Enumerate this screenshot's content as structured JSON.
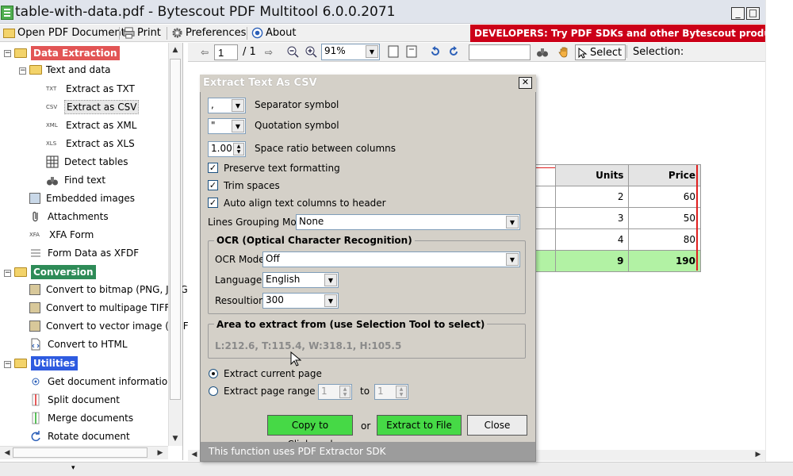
{
  "window": {
    "title": "table-with-data.pdf - Bytescout PDF Multitool 6.0.0.2071",
    "minimize": "_",
    "maximize": "□"
  },
  "menu": {
    "open_pdf": "Open PDF Document",
    "print": "Print",
    "preferences": "Preferences",
    "about": "About",
    "promo": "DEVELOPERS: Try PDF SDKs and other Bytescout products"
  },
  "sidebar": {
    "data_extraction": "Data Extraction",
    "text_and_data": "Text and data",
    "extract_txt_tag": "TXT",
    "extract_txt": "Extract as TXT",
    "extract_csv_tag": "CSV",
    "extract_csv": "Extract as CSV",
    "extract_xml_tag": "XML",
    "extract_xml": "Extract as XML",
    "extract_xls_tag": "XLS",
    "extract_xls": "Extract as XLS",
    "detect_tables": "Detect tables",
    "find_text": "Find text",
    "embedded_images": "Embedded images",
    "attachments": "Attachments",
    "xfa_tag": "XFA",
    "xfa_form": "XFA Form",
    "form_data_xfdf": "Form Data as XFDF",
    "conversion": "Conversion",
    "convert_bitmap": "Convert to bitmap (PNG, JPEG,",
    "convert_tiff": "Convert to multipage TIFF",
    "convert_emf": "Convert to vector image (EMF)",
    "convert_html": "Convert to HTML",
    "utilities": "Utilities",
    "get_info": "Get document information",
    "split": "Split document",
    "merge": "Merge documents",
    "rotate": "Rotate document"
  },
  "viewer": {
    "page_number": "1",
    "page_total": "/ 1",
    "zoom": "91%",
    "select_label": "Select",
    "selection_label": "Selection:",
    "table": {
      "headers": [
        "Units",
        "Price"
      ],
      "rows": [
        [
          "2",
          "60"
        ],
        [
          "3",
          "50"
        ],
        [
          "4",
          "80"
        ]
      ],
      "total": [
        "9",
        "190"
      ]
    }
  },
  "dialog": {
    "title": "Extract Text As CSV",
    "close": "✕",
    "separator_value": ",",
    "separator_label": "Separator symbol",
    "quotation_value": "\"",
    "quotation_label": "Quotation symbol",
    "space_ratio_value": "1.00",
    "space_ratio_label": "Space ratio between columns",
    "preserve_formatting": "Preserve text formatting",
    "trim_spaces": "Trim spaces",
    "auto_align": "Auto align text columns to header",
    "lines_grouping_label": "Lines Grouping Mode",
    "lines_grouping_value": "None",
    "ocr_group": "OCR (Optical Character Recognition)",
    "ocr_mode_label": "OCR Mode",
    "ocr_mode_value": "Off",
    "language_label": "Language",
    "language_value": "English",
    "resolution_label": "Resoultion",
    "resolution_value": "300",
    "area_group": "Area to extract from (use Selection Tool to select)",
    "area_value": "L:212.6, T:115.4, W:318.1, H:105.5",
    "extract_current": "Extract current page",
    "extract_range": "Extract page range from",
    "range_from": "1",
    "range_to_label": "to",
    "range_to": "1",
    "copy_clipboard": "Copy to Clipboard",
    "or_label": "or",
    "extract_file": "Extract to File",
    "close_button": "Close",
    "footer": "This function uses PDF Extractor SDK"
  },
  "colors": {
    "promo": "#cc0018",
    "data_extraction": "#e25555",
    "conversion": "#2e8b57",
    "utilities": "#2e5be0",
    "green_button": "#46d946",
    "total_row": "#b2f2a4"
  }
}
